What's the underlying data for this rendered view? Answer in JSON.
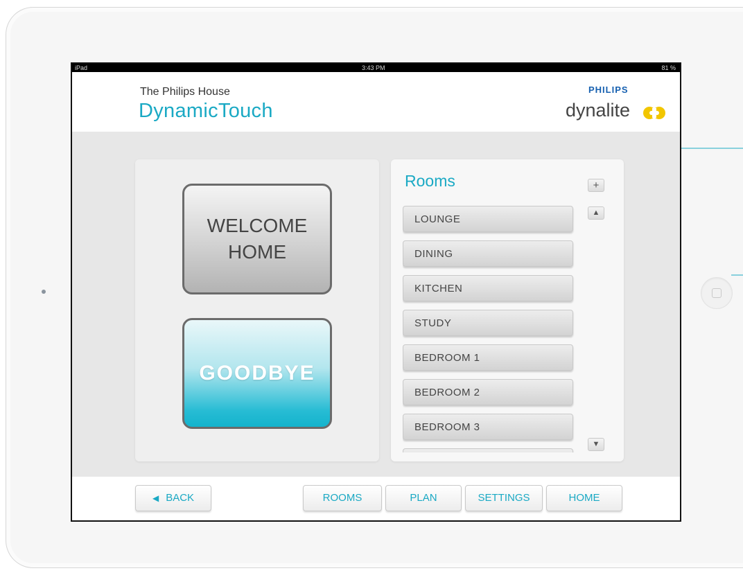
{
  "status_bar": {
    "device": "iPad",
    "time": "3:43 PM",
    "battery": "81 %"
  },
  "header": {
    "house": "The Philips House",
    "app_title": "DynamicTouch",
    "brand_philips": "PHILIPS",
    "brand_dynalite": "dynalite"
  },
  "scenes": {
    "welcome_label": "WELCOME\nHOME",
    "goodbye_label": "GOODBYE"
  },
  "rooms": {
    "title": "Rooms",
    "plus_label": "+",
    "up_label": "▲",
    "down_label": "▼",
    "items": [
      {
        "label": "LOUNGE"
      },
      {
        "label": "DINING"
      },
      {
        "label": "KITCHEN"
      },
      {
        "label": "STUDY"
      },
      {
        "label": "BEDROOM 1"
      },
      {
        "label": "BEDROOM 2"
      },
      {
        "label": "BEDROOM 3"
      },
      {
        "label": ""
      }
    ]
  },
  "nav": {
    "back_icon": "◀",
    "back": "BACK",
    "rooms": "ROOMS",
    "plan": "PLAN",
    "settings": "SETTINGS",
    "home": "HOME"
  },
  "colors": {
    "accent": "#1aa9c4",
    "brand_blue": "#1660b0",
    "logo_yellow": "#f2c600"
  }
}
